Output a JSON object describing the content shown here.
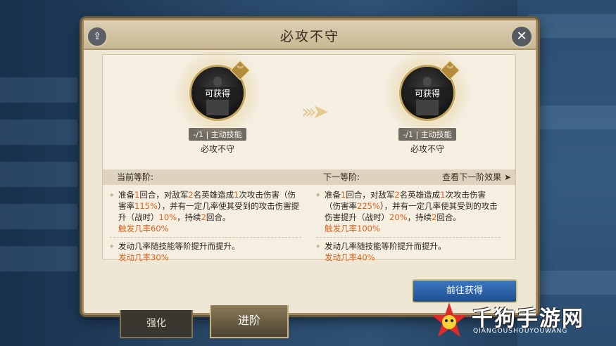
{
  "dialog": {
    "title": "必攻不守"
  },
  "current": {
    "badge_label": "可获得",
    "type_tag": "-/1 | 主动技能",
    "name": "必攻不守",
    "header": "当前等阶:",
    "desc_parts": [
      {
        "t": "准备"
      },
      {
        "t": "1",
        "hl": true
      },
      {
        "t": "回合，对敌军"
      },
      {
        "t": "2",
        "hl": true
      },
      {
        "t": "名英雄造成"
      },
      {
        "t": "1",
        "hl": true
      },
      {
        "t": "次攻击伤害（伤害率"
      },
      {
        "t": "115%",
        "hl": true
      },
      {
        "t": "），并有一定几率使其受到的攻击伤害提升（战时）"
      },
      {
        "t": "10%",
        "hl": true
      },
      {
        "t": "，持续"
      },
      {
        "t": "2",
        "hl": true
      },
      {
        "t": "回合。"
      }
    ],
    "trigger": "触发几率60%",
    "note": "发动几率随技能等阶提升而提升。",
    "activate": "发动几率30%"
  },
  "next": {
    "badge_label": "可获得",
    "type_tag": "-/1 | 主动技能",
    "name": "必攻不守",
    "header": "下一等阶:",
    "view_next": "查看下一阶效果 ➤",
    "desc_parts": [
      {
        "t": "准备"
      },
      {
        "t": "1",
        "hl": true
      },
      {
        "t": "回合，对敌军"
      },
      {
        "t": "2",
        "hl": true
      },
      {
        "t": "名英雄造成"
      },
      {
        "t": "1",
        "hl": true
      },
      {
        "t": "次攻击伤害（伤害率"
      },
      {
        "t": "225%",
        "hl": true
      },
      {
        "t": "），并有一定几率使其受到的攻击伤害提升（战时）"
      },
      {
        "t": "20%",
        "hl": true
      },
      {
        "t": "，持续"
      },
      {
        "t": "2",
        "hl": true
      },
      {
        "t": "回合。"
      }
    ],
    "trigger": "触发几率100%",
    "note": "发动几率随技能等阶提升而提升。",
    "activate": "发动几率40%"
  },
  "go_button": "前往获得",
  "tabs": {
    "strengthen": "强化",
    "advance": "进阶"
  },
  "watermark": {
    "name": "千狗手游网",
    "sub": "QIANGOUSHOUYOUWANG"
  },
  "colors": {
    "highlight": "#d8621a",
    "button_blue": "#2d64aa",
    "frame_gold": "#c6a55f"
  }
}
